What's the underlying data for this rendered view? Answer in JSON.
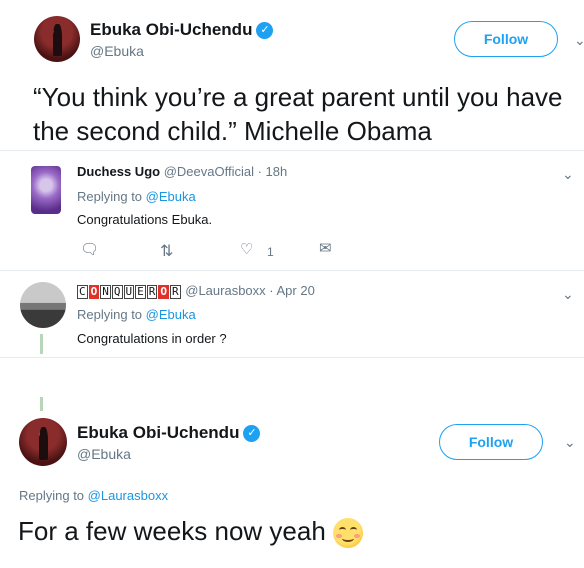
{
  "main_tweet": {
    "author_name": "Ebuka Obi-Uchendu",
    "author_handle": "@Ebuka",
    "follow_label": "Follow",
    "text": "“You think you’re a great parent until you have the second child.” Michelle Obama"
  },
  "replies": [
    {
      "author_name": "Duchess Ugo",
      "author_handle": "@DeevaOfficial",
      "time": "· 18h",
      "replying_prefix": "Replying to",
      "replying_to": "@Ebuka",
      "text": "Congratulations Ebuka.",
      "like_count": "1"
    },
    {
      "author_name_letters": [
        "C",
        "O",
        "N",
        "Q",
        "U",
        "E",
        "R",
        "O",
        "R"
      ],
      "author_handle": "@Laurasboxx",
      "time": "· Apr 20",
      "replying_prefix": "Replying to",
      "replying_to": "@Ebuka",
      "text": "Congratulations in order ?"
    }
  ],
  "focus_tweet": {
    "author_name": "Ebuka Obi-Uchendu",
    "author_handle": "@Ebuka",
    "follow_label": "Follow",
    "replying_prefix": "Replying to",
    "replying_to": "@Laurasboxx",
    "text": "For a few weeks now yeah"
  },
  "icons": {
    "verified": "verified-check-icon",
    "chevron": "chevron-down-icon",
    "reply": "reply-icon",
    "retweet": "retweet-icon",
    "like": "heart-icon",
    "dm": "envelope-icon",
    "emoji": "smiling-face-emoji"
  },
  "colors": {
    "accent": "#1da1f2",
    "link": "#1b95e0",
    "muted": "#657786",
    "text": "#14171a"
  }
}
